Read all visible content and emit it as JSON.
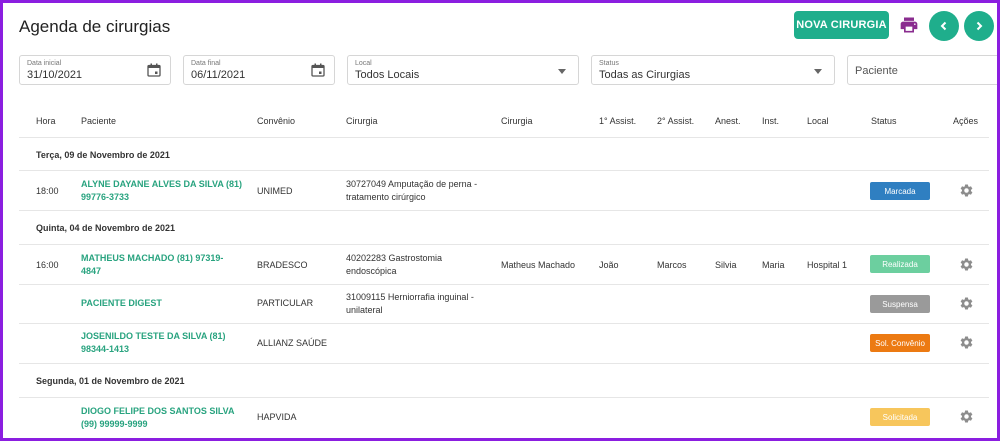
{
  "page": {
    "title": "Agenda de cirurgias"
  },
  "toolbar": {
    "new_label": "NOVA CIRURGIA",
    "print_icon": "print-icon",
    "prev_icon": "chevron-left-icon",
    "next_icon": "chevron-right-icon"
  },
  "filters": {
    "start_date": {
      "label": "Data inicial",
      "value": "31/10/2021"
    },
    "end_date": {
      "label": "Data final",
      "value": "06/11/2021"
    },
    "local": {
      "label": "Local",
      "value": "Todos Locais"
    },
    "status": {
      "label": "Status",
      "value": "Todas as Cirurgias"
    },
    "patient": {
      "placeholder": "Paciente"
    }
  },
  "columns": [
    "Hora",
    "Paciente",
    "Convênio",
    "Cirurgia",
    "Cirurgia",
    "1° Assist.",
    "2° Assist.",
    "Anest.",
    "Inst.",
    "Local",
    "Status",
    "Ações"
  ],
  "groups": [
    {
      "date": "Terça, 09 de Novembro de 2021"
    },
    {
      "date": "Quinta, 04 de Novembro de 2021"
    },
    {
      "date": "Segunda, 01 de Novembro de 2021"
    }
  ],
  "rows": [
    {
      "hora": "18:00",
      "paciente1": "ALYNE DAYANE ALVES DA SILVA (81)",
      "paciente2": "99776-3733",
      "convenio": "UNIMED",
      "cirurgia1": "30727049 Amputação de perna -",
      "cirurgia2": "tratamento cirúrgico",
      "cirurgiao": "",
      "assist1": "",
      "assist2": "",
      "anest": "",
      "inst": "",
      "local": "",
      "status": "Marcada"
    },
    {
      "hora": "16:00",
      "paciente1": "MATHEUS MACHADO (81) 97319-",
      "paciente2": "4847",
      "convenio": "BRADESCO",
      "cirurgia1": "40202283 Gastrostomia",
      "cirurgia2": "endoscópica",
      "cirurgiao": "Matheus Machado",
      "assist1": "João",
      "assist2": "Marcos",
      "anest": "Silvia",
      "inst": "Maria",
      "local": "Hospital 1",
      "status": "Realizada"
    },
    {
      "hora": "",
      "paciente1": "PACIENTE DIGEST",
      "paciente2": "",
      "convenio": "PARTICULAR",
      "cirurgia1": "31009115 Herniorrafia inguinal -",
      "cirurgia2": "unilateral",
      "cirurgiao": "",
      "assist1": "",
      "assist2": "",
      "anest": "",
      "inst": "",
      "local": "",
      "status": "Suspensa"
    },
    {
      "hora": "",
      "paciente1": "JOSENILDO TESTE DA SILVA (81)",
      "paciente2": "98344-1413",
      "convenio": "ALLIANZ SAÚDE",
      "cirurgia1": "",
      "cirurgia2": "",
      "cirurgiao": "",
      "assist1": "",
      "assist2": "",
      "anest": "",
      "inst": "",
      "local": "",
      "status": "Sol. Convênio"
    },
    {
      "hora": "",
      "paciente1": "DIOGO FELIPE DOS SANTOS SILVA",
      "paciente2": "(99) 99999-9999",
      "convenio": "HAPVIDA",
      "cirurgia1": "",
      "cirurgia2": "",
      "cirurgiao": "",
      "assist1": "",
      "assist2": "",
      "anest": "",
      "inst": "",
      "local": "",
      "status": "Solicitada"
    }
  ],
  "status_colors": {
    "Marcada": "#2f7fc1",
    "Realizada": "#6ccf9f",
    "Suspensa": "#9a9a9a",
    "Sol. Convênio": "#ec7a12",
    "Solicitada": "#f7c65c"
  },
  "accent": "#1fae8c",
  "frame_color": "#8b1ee0"
}
